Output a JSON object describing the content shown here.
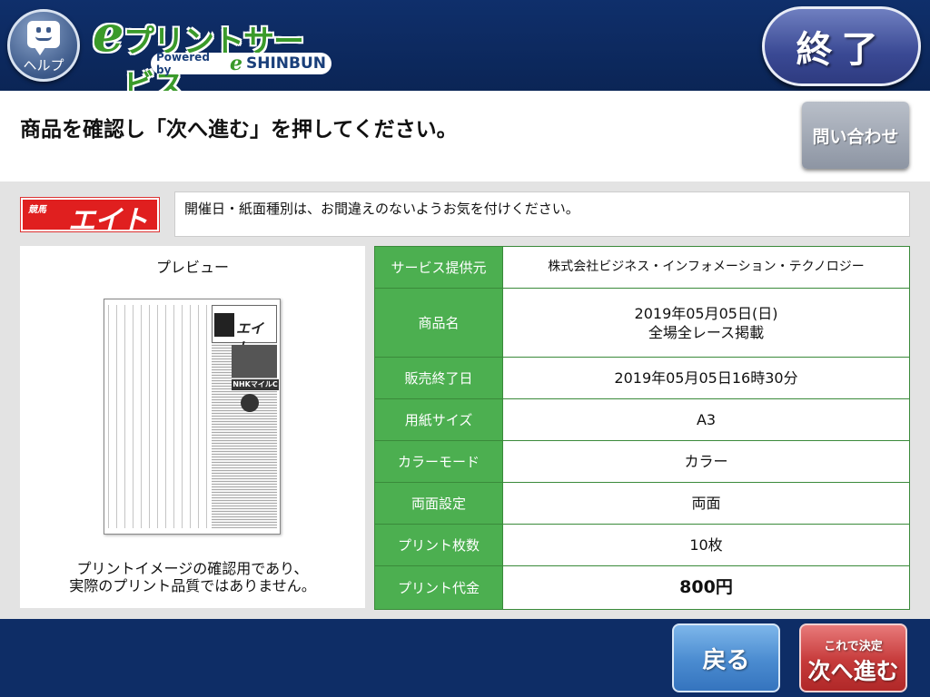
{
  "header": {
    "help_label": "ヘルプ",
    "logo_e": "e",
    "logo_title": "プリントサービス",
    "logo_powered_by": "Powered by",
    "logo_powered_e": "e",
    "logo_powered_name": "SHINBUN",
    "end_button": "終了"
  },
  "instruction": {
    "text": "商品を確認し「次へ進む」を押してください。",
    "inquiry_button": "問い合わせ"
  },
  "brand": {
    "small_text": "競馬",
    "big_text": "エイト"
  },
  "notice": "開催日・紙面種別は、お間違えのないようお気を付けください。",
  "preview": {
    "title": "プレビュー",
    "caption_line1": "プリントイメージの確認用であり、",
    "caption_line2": "実際のプリント品質ではありません。",
    "np_brand": "エイト",
    "np_banner": "NHKマイルC"
  },
  "details": [
    {
      "label": "サービス提供元",
      "value": "株式会社ビジネス・インフォメーション・テクノロジー",
      "value2": ""
    },
    {
      "label": "商品名",
      "value": "2019年05月05日(日)",
      "value2": "全場全レース掲載"
    },
    {
      "label": "販売終了日",
      "value": "2019年05月05日16時30分",
      "value2": ""
    },
    {
      "label": "用紙サイズ",
      "value": "A3",
      "value2": ""
    },
    {
      "label": "カラーモード",
      "value": "カラー",
      "value2": ""
    },
    {
      "label": "両面設定",
      "value": "両面",
      "value2": ""
    },
    {
      "label": "プリント枚数",
      "value": "10枚",
      "value2": ""
    },
    {
      "label": "プリント代金",
      "value": "800円",
      "value2": ""
    }
  ],
  "footer": {
    "back_button": "戻る",
    "next_button_sub": "これで決定",
    "next_button_main": "次へ進む"
  },
  "colors": {
    "header_bg": "#0f2f6b",
    "table_label_bg": "#4caf50",
    "next_button": "#c63a3a",
    "back_button": "#4a8bd0"
  }
}
